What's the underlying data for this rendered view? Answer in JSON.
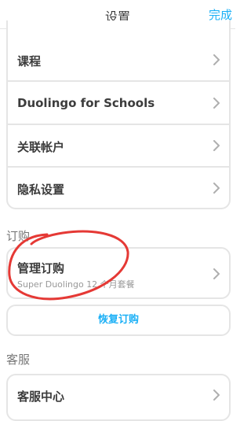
{
  "header": {
    "title": "设置",
    "done_label": "完成"
  },
  "account_rows": [
    {
      "label": "课程"
    },
    {
      "label": "Duolingo for Schools"
    },
    {
      "label": "关联帐户"
    },
    {
      "label": "隐私设置"
    }
  ],
  "subscription": {
    "section_label": "订购",
    "manage_title": "管理订购",
    "manage_subtitle": "Super Duolingo 12 个月套餐",
    "restore_label": "恢复订购"
  },
  "support": {
    "section_label": "客服",
    "help_center_label": "客服中心"
  },
  "colors": {
    "accent": "#1cb0f6",
    "annotation": "#e53935",
    "border": "#e5e5e5"
  },
  "icons": {
    "row_chevron": "chevron-right-icon"
  }
}
